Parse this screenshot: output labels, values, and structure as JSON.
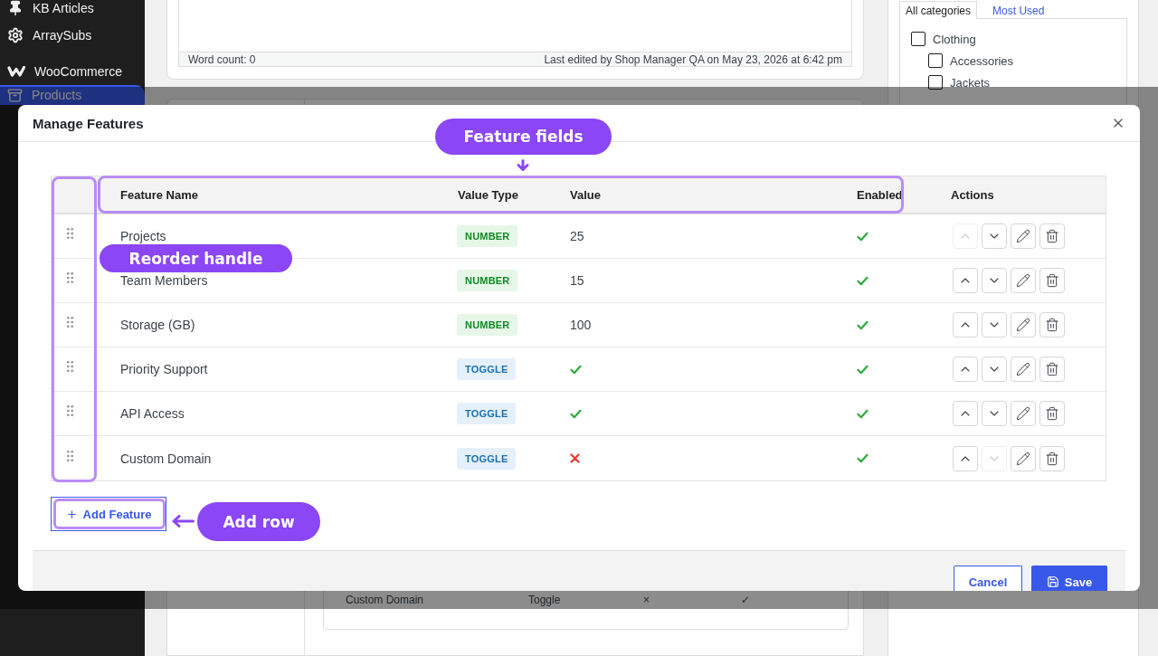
{
  "admin_menu": [
    {
      "label": "KB Articles",
      "selected": false
    },
    {
      "label": "ArraySubs",
      "selected": false
    },
    {
      "label": "WooCommerce",
      "selected": false
    },
    {
      "label": "Products",
      "selected": true
    }
  ],
  "editor": {
    "word_count": "Word count: 0",
    "last_edited": "Last edited by Shop Manager QA on May 23, 2026 at 6:42 pm"
  },
  "categories": {
    "tabs": [
      {
        "label": "All categories",
        "selected": true
      },
      {
        "label": "Most Used",
        "selected": false
      }
    ],
    "items": [
      {
        "label": "Clothing",
        "checked": false,
        "children": [
          {
            "label": "Accessories",
            "checked": false
          },
          {
            "label": "Jackets",
            "checked": false
          }
        ]
      }
    ]
  },
  "product_data": {
    "row": [
      "Custom Domain",
      "Toggle",
      "×",
      "✓"
    ]
  },
  "modal": {
    "title": "Manage Features",
    "columns": [
      "Feature Name",
      "Value Type",
      "Value",
      "Enabled",
      "Actions"
    ],
    "rows": [
      {
        "name": "Projects",
        "type": {
          "label": "NUMBER",
          "kind": "number"
        },
        "value": {
          "kind": "text",
          "text": "25"
        },
        "enabled": true,
        "up_disabled": true,
        "down_disabled": false
      },
      {
        "name": "Team Members",
        "type": {
          "label": "NUMBER",
          "kind": "number"
        },
        "value": {
          "kind": "text",
          "text": "15"
        },
        "enabled": true,
        "up_disabled": false,
        "down_disabled": false
      },
      {
        "name": "Storage (GB)",
        "type": {
          "label": "NUMBER",
          "kind": "number"
        },
        "value": {
          "kind": "text",
          "text": "100"
        },
        "enabled": true,
        "up_disabled": false,
        "down_disabled": false
      },
      {
        "name": "Priority Support",
        "type": {
          "label": "TOGGLE",
          "kind": "toggle"
        },
        "value": {
          "kind": "toggle",
          "on": true
        },
        "enabled": true,
        "up_disabled": false,
        "down_disabled": false
      },
      {
        "name": "API Access",
        "type": {
          "label": "TOGGLE",
          "kind": "toggle"
        },
        "value": {
          "kind": "toggle",
          "on": true
        },
        "enabled": true,
        "up_disabled": false,
        "down_disabled": false
      },
      {
        "name": "Custom Domain",
        "type": {
          "label": "TOGGLE",
          "kind": "toggle"
        },
        "value": {
          "kind": "toggle",
          "on": false
        },
        "enabled": true,
        "up_disabled": false,
        "down_disabled": true
      }
    ],
    "add_button": "Add Feature",
    "footer_buttons": [
      {
        "label": "Cancel",
        "kind": "secondary"
      },
      {
        "label": "Save",
        "kind": "primary"
      }
    ]
  },
  "annotations": [
    {
      "label": "Feature fields",
      "kind": "fields"
    },
    {
      "label": "Reorder handle",
      "kind": "handle"
    },
    {
      "label": "Add row",
      "kind": "add"
    }
  ]
}
